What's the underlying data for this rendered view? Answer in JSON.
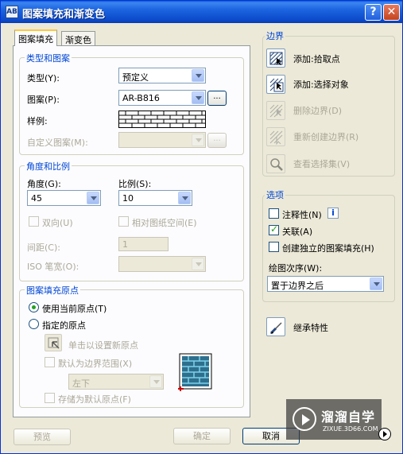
{
  "window": {
    "title": "图案填充和渐变色",
    "icon_text": "AB",
    "help": "?",
    "close": "✕"
  },
  "tabs": [
    {
      "label": "图案填充",
      "active": true
    },
    {
      "label": "渐变色",
      "active": false
    }
  ],
  "type_pattern": {
    "group": "类型和图案",
    "type_label": "类型(Y):",
    "type_value": "预定义",
    "pattern_label": "图案(P):",
    "pattern_value": "AR-B816",
    "browse": "...",
    "swatch_label": "样例:",
    "custom_label": "自定义图案(M):",
    "custom_value": "",
    "custom_browse": "..."
  },
  "angle_scale": {
    "group": "角度和比例",
    "angle_label": "角度(G):",
    "angle_value": "45",
    "scale_label": "比例(S):",
    "scale_value": "10",
    "double_label": "双向(U)",
    "relative_label": "相对图纸空间(E)",
    "spacing_label": "间距(C):",
    "spacing_value": "1",
    "iso_label": "ISO 笔宽(O):",
    "iso_value": ""
  },
  "origin": {
    "group": "图案填充原点",
    "use_current": "使用当前原点(T)",
    "specified": "指定的原点",
    "click_set": "单击以设置新原点",
    "default_extent": "默认为边界范围(X)",
    "extent_value": "左下",
    "store_default": "存储为默认原点(F)"
  },
  "boundary": {
    "group": "边界",
    "add_pick": "添加:拾取点",
    "add_select": "添加:选择对象",
    "remove": "删除边界(D)",
    "recreate": "重新创建边界(R)",
    "view_selection": "查看选择集(V)"
  },
  "options": {
    "group": "选项",
    "annotative": "注释性(N)",
    "info": "i",
    "associative": "关联(A)",
    "separate": "创建独立的图案填充(H)",
    "draw_order_label": "绘图次序(W):",
    "draw_order_value": "置于边界之后"
  },
  "inherit": "继承特性",
  "buttons": {
    "preview": "预览",
    "ok": "确定",
    "cancel": "取消"
  },
  "watermark": {
    "brand": "溜溜自学",
    "url": "ZIXUE.3D66.COM"
  },
  "colors": {
    "title_bar": "#0b49c9",
    "group_label": "#0046d5",
    "check": "#21a121"
  }
}
